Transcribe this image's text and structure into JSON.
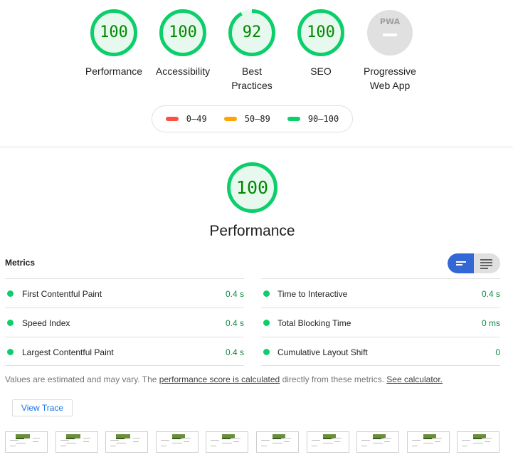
{
  "categories": [
    {
      "score": "100",
      "value": 100,
      "label": "Performance",
      "color": "#0cce6b"
    },
    {
      "score": "100",
      "value": 100,
      "label": "Accessibility",
      "color": "#0cce6b"
    },
    {
      "score": "92",
      "value": 92,
      "label": "Best Practices",
      "color": "#0cce6b"
    },
    {
      "score": "100",
      "value": 100,
      "label": "SEO",
      "color": "#0cce6b"
    }
  ],
  "pwa": {
    "label": "Progressive Web App",
    "badge_text": "PWA"
  },
  "legend": [
    {
      "label": "0–49",
      "color": "#ff4e42"
    },
    {
      "label": "50–89",
      "color": "#ffa400"
    },
    {
      "label": "90–100",
      "color": "#0cce6b"
    }
  ],
  "performance": {
    "score": "100",
    "value": 100,
    "title": "Performance"
  },
  "metrics": {
    "title": "Metrics",
    "left": [
      {
        "name": "First Contentful Paint",
        "value": "0.4 s"
      },
      {
        "name": "Speed Index",
        "value": "0.4 s"
      },
      {
        "name": "Largest Contentful Paint",
        "value": "0.4 s"
      }
    ],
    "right": [
      {
        "name": "Time to Interactive",
        "value": "0.4 s"
      },
      {
        "name": "Total Blocking Time",
        "value": "0 ms"
      },
      {
        "name": "Cumulative Layout Shift",
        "value": "0"
      }
    ]
  },
  "note": {
    "prefix": "Values are estimated and may vary. The",
    "link1": "performance score is calculated",
    "middle": "directly from these metrics.",
    "link2": "See calculator."
  },
  "view_trace_label": "View Trace",
  "filmstrip_frames": 10
}
